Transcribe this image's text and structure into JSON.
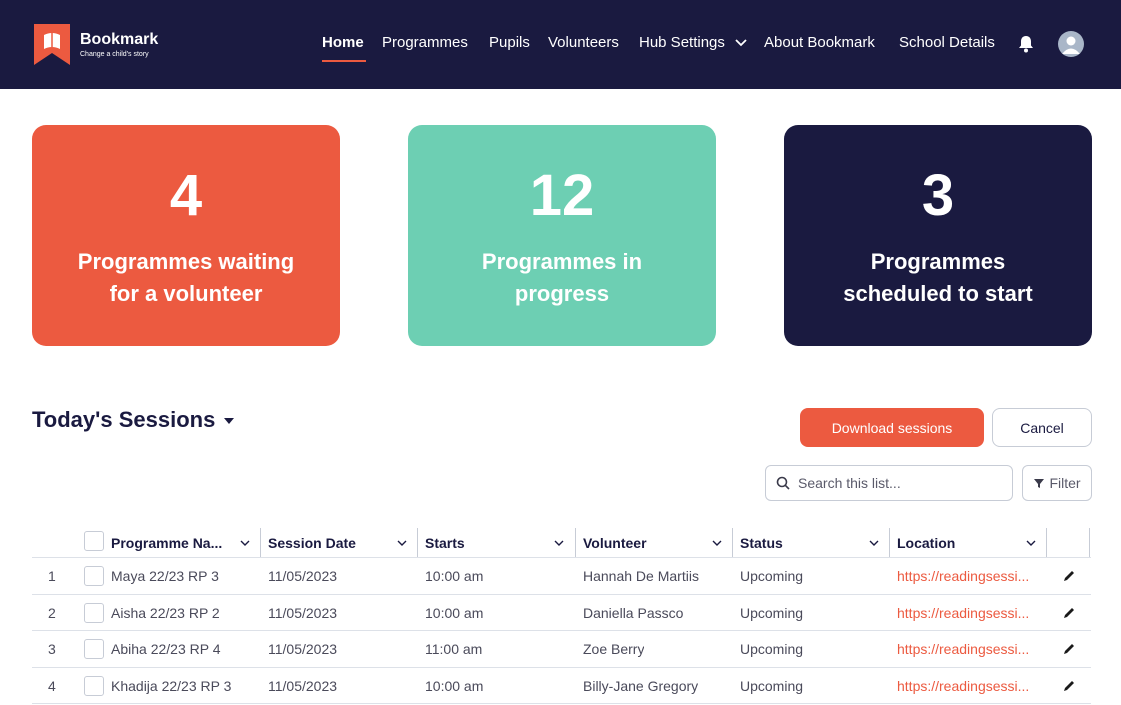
{
  "app": {
    "brand": "Bookmark",
    "tagline": "Change a child's story"
  },
  "nav": {
    "items": [
      {
        "label": "Home",
        "active": true
      },
      {
        "label": "Programmes"
      },
      {
        "label": "Pupils"
      },
      {
        "label": "Volunteers"
      },
      {
        "label": "Hub Settings",
        "has_dropdown": true
      },
      {
        "label": "About Bookmark"
      },
      {
        "label": "School Details"
      }
    ],
    "icons": [
      "bell-icon",
      "avatar"
    ]
  },
  "stats": [
    {
      "value": "4",
      "label": "Programmes waiting for a volunteer",
      "color": "#ec5a40"
    },
    {
      "value": "12",
      "label": "Programmes in progress",
      "color": "#6dcfb3"
    },
    {
      "value": "3",
      "label": "Programmes scheduled to start",
      "color": "#1a1a40"
    }
  ],
  "sessions": {
    "title": "Today's Sessions",
    "download_label": "Download sessions",
    "cancel_label": "Cancel",
    "search_placeholder": "Search this list...",
    "filter_label": "Filter",
    "columns": [
      "Programme Na...",
      "Session Date",
      "Starts",
      "Volunteer",
      "Status",
      "Location"
    ],
    "rows": [
      {
        "num": "1",
        "programme": "Maya 22/23 RP 3",
        "date": "11/05/2023",
        "starts": "10:00 am",
        "volunteer": "Hannah De Martiis",
        "status": "Upcoming",
        "location": "https://readingsessi..."
      },
      {
        "num": "2",
        "programme": "Aisha 22/23 RP 2",
        "date": "11/05/2023",
        "starts": "10:00 am",
        "volunteer": "Daniella Passco",
        "status": "Upcoming",
        "location": "https://readingsessi..."
      },
      {
        "num": "3",
        "programme": "Abiha 22/23 RP 4",
        "date": "11/05/2023",
        "starts": "11:00 am",
        "volunteer": "Zoe Berry",
        "status": "Upcoming",
        "location": "https://readingsessi..."
      },
      {
        "num": "4",
        "programme": "Khadija 22/23 RP 3",
        "date": "11/05/2023",
        "starts": "10:00 am",
        "volunteer": "Billy-Jane Gregory",
        "status": "Upcoming",
        "location": "https://readingsessi..."
      }
    ]
  },
  "colors": {
    "navy": "#1a1a40",
    "accent": "#ec5a40",
    "teal": "#6dcfb3"
  }
}
